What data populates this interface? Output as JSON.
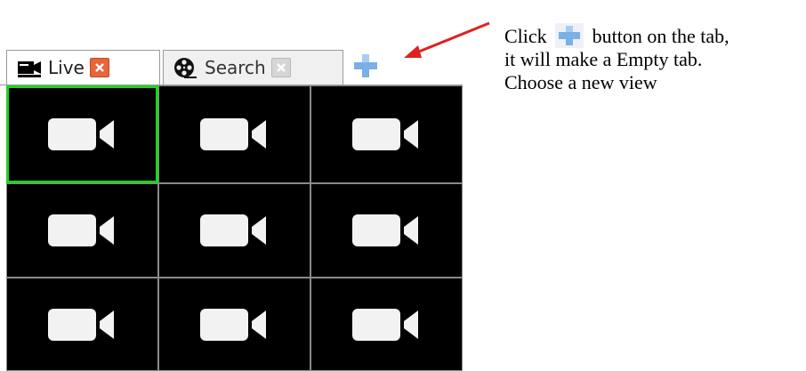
{
  "tabs": [
    {
      "label": "Live",
      "icon": "camera-icon",
      "close_icon": "close-icon",
      "active": true
    },
    {
      "label": "Search",
      "icon": "film-reel-icon",
      "close_icon": "close-icon",
      "active": false
    }
  ],
  "add_tab_icon": "plus-icon",
  "grid": {
    "rows": 3,
    "columns": 3,
    "cell_icon": "video-camera-icon",
    "selected_cell": 0
  },
  "annotation": {
    "line1_before": "Click",
    "line1_after": "button on the tab,",
    "line2": "it will make a Empty tab.",
    "line3": "Choose a new view"
  },
  "colors": {
    "selected_border": "#1fd41f",
    "close_active": "#e8653a",
    "plus": "#7ab0e6",
    "arrow": "#e02020"
  }
}
